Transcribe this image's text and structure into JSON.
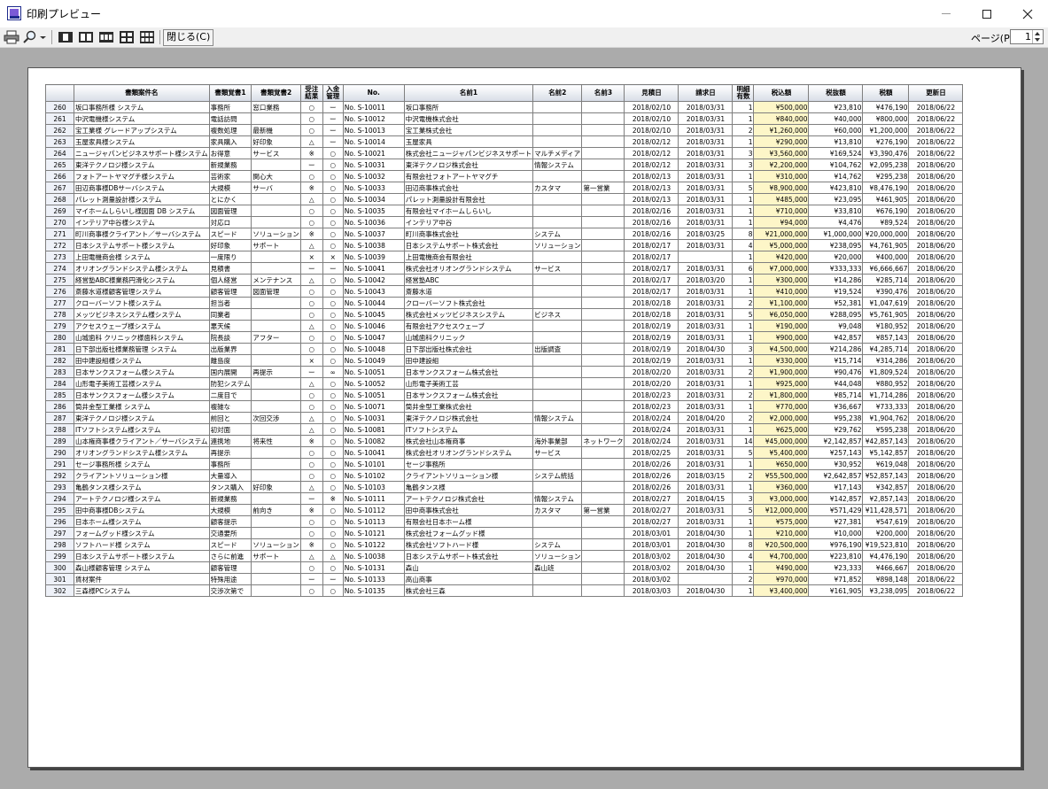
{
  "window": {
    "title": "印刷プレビュー"
  },
  "toolbar": {
    "close_label": "閉じる(C)",
    "page_label": "ページ(P)",
    "page_value": "1"
  },
  "icons": {
    "print": "printer-icon",
    "zoom": "magnifier-icon",
    "dropdown": "chevron-down-icon",
    "pages": [
      "one-page-icon",
      "two-page-icon",
      "three-page-icon",
      "four-page-icon",
      "six-page-icon"
    ]
  },
  "table": {
    "headers": [
      "",
      "書類案件名",
      "書類覚書1",
      "書類覚書2",
      "受注\n結果",
      "入金\n管理",
      "No.",
      "名前1",
      "名前2",
      "名前3",
      "見積日",
      "請求日",
      "明細\n有数",
      "税込額",
      "税抜額",
      "税額",
      "更新日"
    ],
    "rows": [
      [
        "260",
        "坂口事務所様 システム",
        "事務所",
        "窓口業務",
        "○",
        "ー",
        "No. S-10011",
        "坂口事務所",
        "",
        "",
        "2018/02/10",
        "2018/03/31",
        "1",
        "¥500,000",
        "¥23,810",
        "¥476,190",
        "2018/06/22"
      ],
      [
        "261",
        "中沢電機様システム",
        "電話訪問",
        "",
        "○",
        "ー",
        "No. S-10012",
        "中沢電機株式会社",
        "",
        "",
        "2018/02/10",
        "2018/03/31",
        "1",
        "¥840,000",
        "¥40,000",
        "¥800,000",
        "2018/06/22"
      ],
      [
        "262",
        "宝工業様 グレードアップシステム",
        "複数処理",
        "最新機",
        "○",
        "ー",
        "No. S-10013",
        "宝工業株式会社",
        "",
        "",
        "2018/02/10",
        "2018/03/31",
        "2",
        "¥1,260,000",
        "¥60,000",
        "¥1,200,000",
        "2018/06/22"
      ],
      [
        "263",
        "玉屋家具様システム",
        "家具購入",
        "好印象",
        "△",
        "ー",
        "No. S-10014",
        "玉屋家具",
        "",
        "",
        "2018/02/12",
        "2018/03/31",
        "1",
        "¥290,000",
        "¥13,810",
        "¥276,190",
        "2018/06/22"
      ],
      [
        "264",
        "ニュージャパンビジネスサポート様システム",
        "お得意",
        "サービス",
        "※",
        "○",
        "No. S-10021",
        "株式会社ニュージャパンビジネスサポート",
        "マルチメディア",
        "",
        "2018/02/12",
        "2018/03/31",
        "3",
        "¥3,560,000",
        "¥169,524",
        "¥3,390,476",
        "2018/06/22"
      ],
      [
        "265",
        "東洋テクノロジ様システム",
        "新規業務",
        "",
        "ー",
        "○",
        "No. S-10031",
        "東洋テクノロジ株式会社",
        "情報システム",
        "",
        "2018/02/12",
        "2018/03/31",
        "3",
        "¥2,200,000",
        "¥104,762",
        "¥2,095,238",
        "2018/06/20"
      ],
      [
        "266",
        "フォトアートヤマグチ様システム",
        "芸術家",
        "関心大",
        "○",
        "○",
        "No. S-10032",
        "有限会社フォトアートヤマグチ",
        "",
        "",
        "2018/02/13",
        "2018/03/31",
        "1",
        "¥310,000",
        "¥14,762",
        "¥295,238",
        "2018/06/20"
      ],
      [
        "267",
        "田辺商事様DBサーバシステム",
        "大規模",
        "サーバ",
        "※",
        "○",
        "No. S-10033",
        "田辺商事株式会社",
        "カスタマ",
        "第一営業",
        "2018/02/13",
        "2018/03/31",
        "5",
        "¥8,900,000",
        "¥423,810",
        "¥8,476,190",
        "2018/06/20"
      ],
      [
        "268",
        "パレット測量設計様システム",
        "とにかく",
        "",
        "△",
        "○",
        "No. S-10034",
        "パレット測量設計有限会社",
        "",
        "",
        "2018/02/13",
        "2018/03/31",
        "1",
        "¥485,000",
        "¥23,095",
        "¥461,905",
        "2018/06/20"
      ],
      [
        "269",
        "マイホームしらいし様図面 DB システム",
        "図面管理",
        "",
        "○",
        "○",
        "No. S-10035",
        "有限会社マイホームしらいし",
        "",
        "",
        "2018/02/16",
        "2018/03/31",
        "1",
        "¥710,000",
        "¥33,810",
        "¥676,190",
        "2018/06/20"
      ],
      [
        "270",
        "インテリア中谷様システム",
        "対応ロ",
        "",
        "○",
        "○",
        "No. S-10036",
        "インテリア中谷",
        "",
        "",
        "2018/02/16",
        "2018/03/31",
        "1",
        "¥94,000",
        "¥4,476",
        "¥89,524",
        "2018/06/20"
      ],
      [
        "271",
        "町川商事様クライアント／サーバシステム",
        "スピード",
        "ソリューション",
        "※",
        "○",
        "No. S-10037",
        "町川商事株式会社",
        "システム",
        "",
        "2018/02/16",
        "2018/03/25",
        "8",
        "¥21,000,000",
        "¥1,000,000",
        "¥20,000,000",
        "2018/06/20"
      ],
      [
        "272",
        "日本システムサポート様システム",
        "好印象",
        "サポート",
        "△",
        "○",
        "No. S-10038",
        "日本システムサポート株式会社",
        "ソリューション",
        "",
        "2018/02/17",
        "2018/03/31",
        "4",
        "¥5,000,000",
        "¥238,095",
        "¥4,761,905",
        "2018/06/20"
      ],
      [
        "273",
        "上田電機商会様 システム",
        "一度限り",
        "",
        "×",
        "×",
        "No. S-10039",
        "上田電機商会有限会社",
        "",
        "",
        "2018/02/17",
        "",
        "1",
        "¥420,000",
        "¥20,000",
        "¥400,000",
        "2018/06/20"
      ],
      [
        "274",
        "オリオングランドシステム様システム",
        "見積書",
        "",
        "ー",
        "ー",
        "No. S-10041",
        "株式会社オリオングランドシステム",
        "サービス",
        "",
        "2018/02/17",
        "2018/03/31",
        "6",
        "¥7,000,000",
        "¥333,333",
        "¥6,666,667",
        "2018/06/20"
      ],
      [
        "275",
        "経営塾ABC様業務円滑化システム",
        "個人経営",
        "メンテナンス",
        "△",
        "○",
        "No. S-10042",
        "経営塾ABC",
        "",
        "",
        "2018/02/17",
        "2018/03/20",
        "1",
        "¥300,000",
        "¥14,286",
        "¥285,714",
        "2018/06/20"
      ],
      [
        "276",
        "斎藤水道様顧客管理システム",
        "顧客管理",
        "図面管理",
        "○",
        "○",
        "No. S-10043",
        "斎藤水道",
        "",
        "",
        "2018/02/17",
        "2018/03/31",
        "1",
        "¥410,000",
        "¥19,524",
        "¥390,476",
        "2018/06/20"
      ],
      [
        "277",
        "クローバーソフト様システム",
        "担当者",
        "",
        "○",
        "○",
        "No. S-10044",
        "クローバーソフト株式会社",
        "",
        "",
        "2018/02/18",
        "2018/03/31",
        "2",
        "¥1,100,000",
        "¥52,381",
        "¥1,047,619",
        "2018/06/20"
      ],
      [
        "278",
        "メッツビジネスシステム様システム",
        "同業者",
        "",
        "○",
        "○",
        "No. S-10045",
        "株式会社メッツビジネスシステム",
        "ビジネス",
        "",
        "2018/02/18",
        "2018/03/31",
        "5",
        "¥6,050,000",
        "¥288,095",
        "¥5,761,905",
        "2018/06/20"
      ],
      [
        "279",
        "アクセスウェーブ様システム",
        "悪天候",
        "",
        "△",
        "○",
        "No. S-10046",
        "有限会社アクセスウェーブ",
        "",
        "",
        "2018/02/19",
        "2018/03/31",
        "1",
        "¥190,000",
        "¥9,048",
        "¥180,952",
        "2018/06/20"
      ],
      [
        "280",
        "山城歯科 クリニック様歯科システム",
        "院長談",
        "アフター",
        "○",
        "○",
        "No. S-10047",
        "山城歯科クリニック",
        "",
        "",
        "2018/02/19",
        "2018/03/31",
        "1",
        "¥900,000",
        "¥42,857",
        "¥857,143",
        "2018/06/20"
      ],
      [
        "281",
        "日下部出版社様業務管理 システム",
        "出版業界",
        "",
        "○",
        "○",
        "No. S-10048",
        "日下部出版社株式会社",
        "出版調査",
        "",
        "2018/02/19",
        "2018/04/30",
        "3",
        "¥4,500,000",
        "¥214,286",
        "¥4,285,714",
        "2018/06/20"
      ],
      [
        "282",
        "田中建設組様システム",
        "離島度",
        "",
        "×",
        "○",
        "No. S-10049",
        "田中建設組",
        "",
        "",
        "2018/02/19",
        "2018/03/31",
        "1",
        "¥330,000",
        "¥15,714",
        "¥314,286",
        "2018/06/20"
      ],
      [
        "283",
        "日本サンクスフォーム様システム",
        "国内展開",
        "再提示",
        "ー",
        "∞",
        "No. S-10051",
        "日本サンクスフォーム株式会社",
        "",
        "",
        "2018/02/20",
        "2018/03/31",
        "2",
        "¥1,900,000",
        "¥90,476",
        "¥1,809,524",
        "2018/06/20"
      ],
      [
        "284",
        "山形電子美術工芸様システム",
        "防犯システム",
        "",
        "△",
        "○",
        "No. S-10052",
        "山形電子美術工芸",
        "",
        "",
        "2018/02/20",
        "2018/03/31",
        "1",
        "¥925,000",
        "¥44,048",
        "¥880,952",
        "2018/06/20"
      ],
      [
        "285",
        "日本サンクスフォーム様システム",
        "二度目で",
        "",
        "○",
        "○",
        "No. S-10051",
        "日本サンクスフォーム株式会社",
        "",
        "",
        "2018/02/23",
        "2018/03/31",
        "2",
        "¥1,800,000",
        "¥85,714",
        "¥1,714,286",
        "2018/06/20"
      ],
      [
        "286",
        "筒井金型工業様 システム",
        "複雑な",
        "",
        "○",
        "○",
        "No. S-10071",
        "筒井金型工業株式会社",
        "",
        "",
        "2018/02/23",
        "2018/03/31",
        "1",
        "¥770,000",
        "¥36,667",
        "¥733,333",
        "2018/06/20"
      ],
      [
        "287",
        "東洋テクノロジ様システム",
        "前回と",
        "次回交渉",
        "△",
        "○",
        "No. S-10031",
        "東洋テクノロジ株式会社",
        "情報システム",
        "",
        "2018/02/24",
        "2018/04/20",
        "2",
        "¥2,000,000",
        "¥95,238",
        "¥1,904,762",
        "2018/06/20"
      ],
      [
        "288",
        "ITソフトシステム様システム",
        "初対面",
        "",
        "△",
        "○",
        "No. S-10081",
        "ITソフトシステム",
        "",
        "",
        "2018/02/24",
        "2018/03/31",
        "1",
        "¥625,000",
        "¥29,762",
        "¥595,238",
        "2018/06/20"
      ],
      [
        "289",
        "山本権商事様クライアント／サーバシステム",
        "連携地",
        "将来性",
        "※",
        "○",
        "No. S-10082",
        "株式会社山本権商事",
        "海外事業部",
        "ネットワーク",
        "2018/02/24",
        "2018/03/31",
        "14",
        "¥45,000,000",
        "¥2,142,857",
        "¥42,857,143",
        "2018/06/20"
      ],
      [
        "290",
        "オリオングランドシステム様システム",
        "再提示",
        "",
        "○",
        "○",
        "No. S-10041",
        "株式会社オリオングランドシステム",
        "サービス",
        "",
        "2018/02/25",
        "2018/03/31",
        "5",
        "¥5,400,000",
        "¥257,143",
        "¥5,142,857",
        "2018/06/20"
      ],
      [
        "291",
        "セージ事務所様 システム",
        "事務所",
        "",
        "○",
        "○",
        "No. S-10101",
        "セージ事務所",
        "",
        "",
        "2018/02/26",
        "2018/03/31",
        "1",
        "¥650,000",
        "¥30,952",
        "¥619,048",
        "2018/06/20"
      ],
      [
        "292",
        "クライアントソリューション様",
        "大量導入",
        "",
        "○",
        "○",
        "No. S-10102",
        "クライアントソリューション様",
        "システム統括",
        "",
        "2018/02/26",
        "2018/03/15",
        "2",
        "¥55,500,000",
        "¥2,642,857",
        "¥52,857,143",
        "2018/06/20"
      ],
      [
        "293",
        "亀鶴タンス様システム",
        "タンス購入",
        "好印象",
        "△",
        "○",
        "No. S-10103",
        "亀鶴タンス様",
        "",
        "",
        "2018/02/26",
        "2018/03/31",
        "1",
        "¥360,000",
        "¥17,143",
        "¥342,857",
        "2018/06/20"
      ],
      [
        "294",
        "アートテクノロジ様システム",
        "新規業務",
        "",
        "ー",
        "※",
        "No. S-10111",
        "アートテクノロジ株式会社",
        "情報システム",
        "",
        "2018/02/27",
        "2018/04/15",
        "3",
        "¥3,000,000",
        "¥142,857",
        "¥2,857,143",
        "2018/06/20"
      ],
      [
        "295",
        "田中商事様DBシステム",
        "大規模",
        "前向き",
        "※",
        "○",
        "No. S-10112",
        "田中商事株式会社",
        "カスタマ",
        "第一営業",
        "2018/02/27",
        "2018/03/31",
        "5",
        "¥12,000,000",
        "¥571,429",
        "¥11,428,571",
        "2018/06/20"
      ],
      [
        "296",
        "日本ホーム様システム",
        "顧客提示",
        "",
        "○",
        "○",
        "No. S-10113",
        "有限会社日本ホーム様",
        "",
        "",
        "2018/02/27",
        "2018/03/31",
        "1",
        "¥575,000",
        "¥27,381",
        "¥547,619",
        "2018/06/20"
      ],
      [
        "297",
        "フォームグッド様システム",
        "交通要所",
        "",
        "○",
        "○",
        "No. S-10121",
        "株式会社フォームグッド様",
        "",
        "",
        "2018/03/01",
        "2018/04/30",
        "1",
        "¥210,000",
        "¥10,000",
        "¥200,000",
        "2018/06/20"
      ],
      [
        "298",
        "ソフトハード様 システム",
        "スピード",
        "ソリューション",
        "※",
        "○",
        "No. S-10122",
        "株式会社ソフトハード様",
        "システム",
        "",
        "2018/03/01",
        "2018/04/30",
        "8",
        "¥20,500,000",
        "¥976,190",
        "¥19,523,810",
        "2018/06/20"
      ],
      [
        "299",
        "日本システムサポート様システム",
        "さらに前進",
        "サポート",
        "△",
        "△",
        "No. S-10038",
        "日本システムサポート株式会社",
        "ソリューション",
        "",
        "2018/03/02",
        "2018/04/30",
        "4",
        "¥4,700,000",
        "¥223,810",
        "¥4,476,190",
        "2018/06/20"
      ],
      [
        "300",
        "森山様顧客管理 システム",
        "顧客管理",
        "",
        "○",
        "○",
        "No. S-10131",
        "森山",
        "森山班",
        "",
        "2018/03/02",
        "2018/04/30",
        "1",
        "¥490,000",
        "¥23,333",
        "¥466,667",
        "2018/06/20"
      ],
      [
        "301",
        "賃材案件",
        "特殊用途",
        "",
        "ー",
        "ー",
        "No. S-10133",
        "高山商事",
        "",
        "",
        "2018/03/02",
        "",
        "2",
        "¥970,000",
        "¥71,852",
        "¥898,148",
        "2018/06/22"
      ],
      [
        "302",
        "三森様PCシステム",
        "交渉次第で",
        "",
        "○",
        "○",
        "No. S-10135",
        "株式会社三森",
        "",
        "",
        "2018/03/03",
        "2018/04/30",
        "1",
        "¥3,400,000",
        "¥161,905",
        "¥3,238,095",
        "2018/06/22"
      ]
    ]
  }
}
